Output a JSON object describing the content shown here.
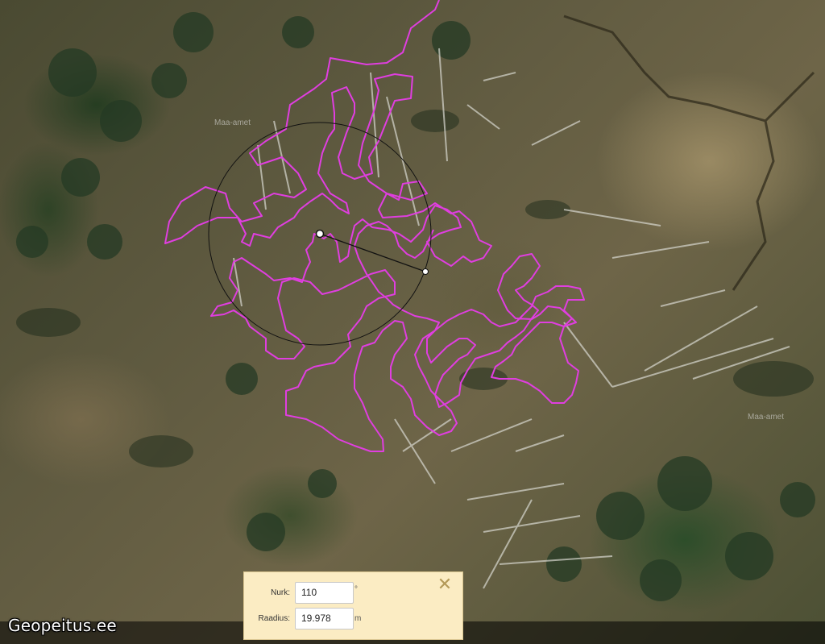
{
  "map": {
    "labels": [
      "Maa-amet",
      "Maa-amet"
    ],
    "track_color": "#e03ee0",
    "circle_color": "#111111"
  },
  "brand": {
    "text": "Geopeitus.ee"
  },
  "panel": {
    "angle_label": "Nurk:",
    "angle_value": "110",
    "angle_unit": "°",
    "radius_label": "Raadius:",
    "radius_value": "19.978",
    "radius_unit": "m",
    "close_glyph": "✕"
  }
}
